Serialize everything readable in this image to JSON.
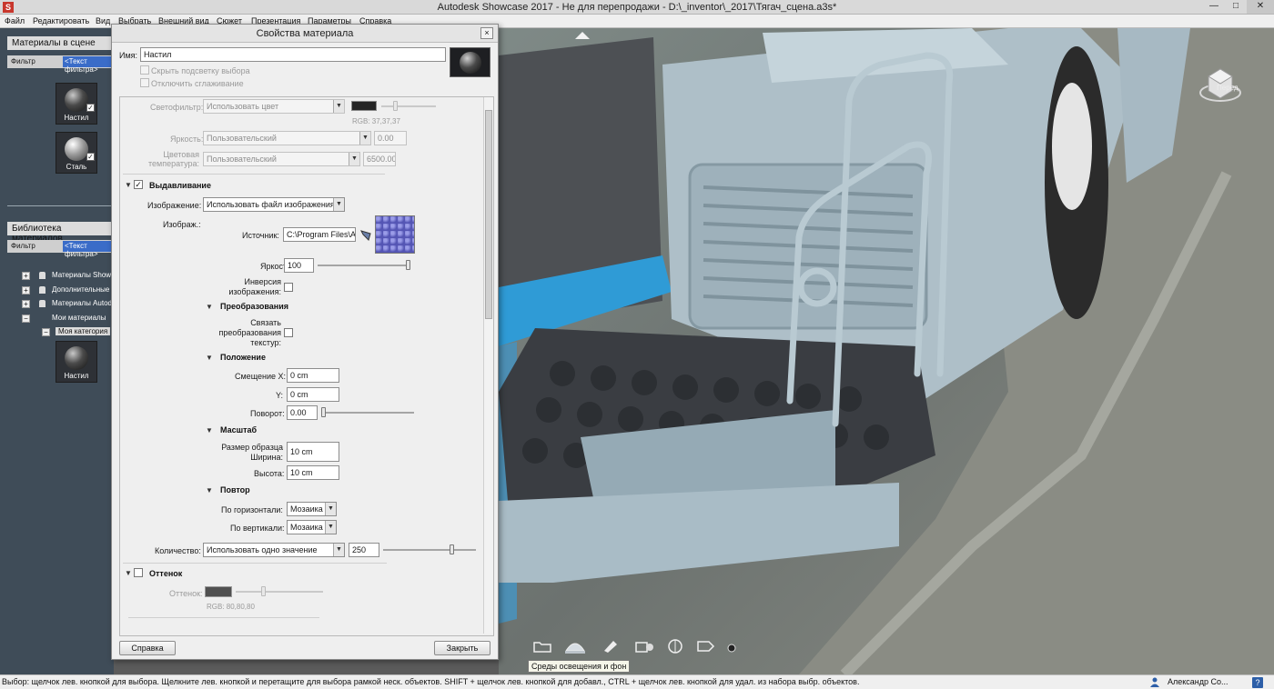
{
  "window": {
    "app_letter": "S",
    "title": "Autodesk Showcase 2017 - Не для перепродажи - D:\\_inventor\\_2017\\Тягач_сцена.a3s*",
    "min": "—",
    "max": "□",
    "close": "✕"
  },
  "menu": [
    "Файл",
    "Редактировать",
    "Вид",
    "Выбрать",
    "Внешний вид",
    "Сюжет",
    "Презентация",
    "Параметры",
    "Справка"
  ],
  "left_panel": {
    "scene_materials_title": "Материалы в сцене",
    "filter_label": "Фильтр",
    "filter_value": "<Текст фильтра>",
    "scene_thumbs": [
      "Настил",
      "Сталь"
    ],
    "library_title": "Библиотека материалов",
    "library_filter_label": "Фильтр",
    "library_filter_value": "<Текст фильтра>",
    "tree": [
      "Материалы Showcase",
      "Дополнительные",
      "Материалы Autodesk",
      "Мои материалы",
      "Моя категория"
    ],
    "library_thumb": "Настил"
  },
  "dialog": {
    "title": "Свойства материала",
    "close": "×",
    "name_label": "Имя:",
    "name_value": "Настил",
    "highlight_label": "Скрыть подсветку выбора",
    "antialias_label": "Отключить сглаживание",
    "color_filter_label": "Светофильтр:",
    "color_filter_value": "Использовать цвет",
    "rgb_color_filter": "RGB: 37,37,37",
    "brightness_label": "Яркость:",
    "brightness_value": "Пользовательский",
    "brightness_num": "0.00",
    "color_temp_label": "Цветовая температура:",
    "color_temp_value": "Пользовательский",
    "color_temp_num": "6500.00",
    "bump": {
      "title": "Выдавливание",
      "checked": true,
      "image_label": "Изображение:",
      "image_value": "Использовать файл изображения",
      "image_sub": "Изображ.:",
      "source_label": "Источник:",
      "source_value": "C:\\Program Files\\A",
      "brightness_label": "Яркость:",
      "brightness_value": "100",
      "brightness_level": 1.0,
      "invert_label": "Инверсия изображения:"
    },
    "transform": {
      "title": "Преобразования",
      "link_label": "Связать преобразования текстур:"
    },
    "position": {
      "title": "Положение",
      "offset_x_label": "Смещение X:",
      "offset_x": "0 cm",
      "offset_y_label": "Y:",
      "offset_y": "0 cm",
      "rotation_label": "Поворот:",
      "rotation": "0.00",
      "rotation_level": 0.0
    },
    "scale": {
      "title": "Масштаб",
      "width_label": "Размер образца Ширина:",
      "width": "10 cm",
      "height_label": "Высота:",
      "height": "10 cm"
    },
    "repeat": {
      "title": "Повтор",
      "horizontal_label": "По горизонтали:",
      "horizontal": "Мозаика",
      "vertical_label": "По вертикали:",
      "vertical": "Мозаика"
    },
    "quantity_label": "Количество:",
    "quantity_value": "Использовать одно значение",
    "quantity_num": "250",
    "quantity_level": 0.75,
    "tint": {
      "title": "Оттенок",
      "checked": false,
      "label": "Оттенок:",
      "rgb": "RGB: 80,80,80"
    },
    "help_button": "Справка",
    "close_button": "Закрыть"
  },
  "viewport": {
    "viewcube_label": "Перед",
    "tooltip": "Среды освещения и фон",
    "toolbar_icons": [
      "folder-icon",
      "environment-icon",
      "light-icon",
      "camera-icon",
      "sphere-icon",
      "tag-icon",
      "settings-icon"
    ]
  },
  "status": {
    "text": "Выбор: щелчок лев. кнопкой для выбора. Щелкните лев. кнопкой и перетащите для выбора рамкой неск. объектов. SHIFT + щелчок лев. кнопкой для добавл., CTRL + щелчок лев. кнопкой для удал. из набора выбр. объектов.",
    "user": "Александр Со...",
    "help": "?"
  },
  "colors": {
    "accent_blue": "#3a6cc8",
    "viewport_cab": "#a9bcc6",
    "floor_dark": "#3c3f44",
    "color_swatch": "#252525",
    "tint_swatch": "#505050"
  }
}
